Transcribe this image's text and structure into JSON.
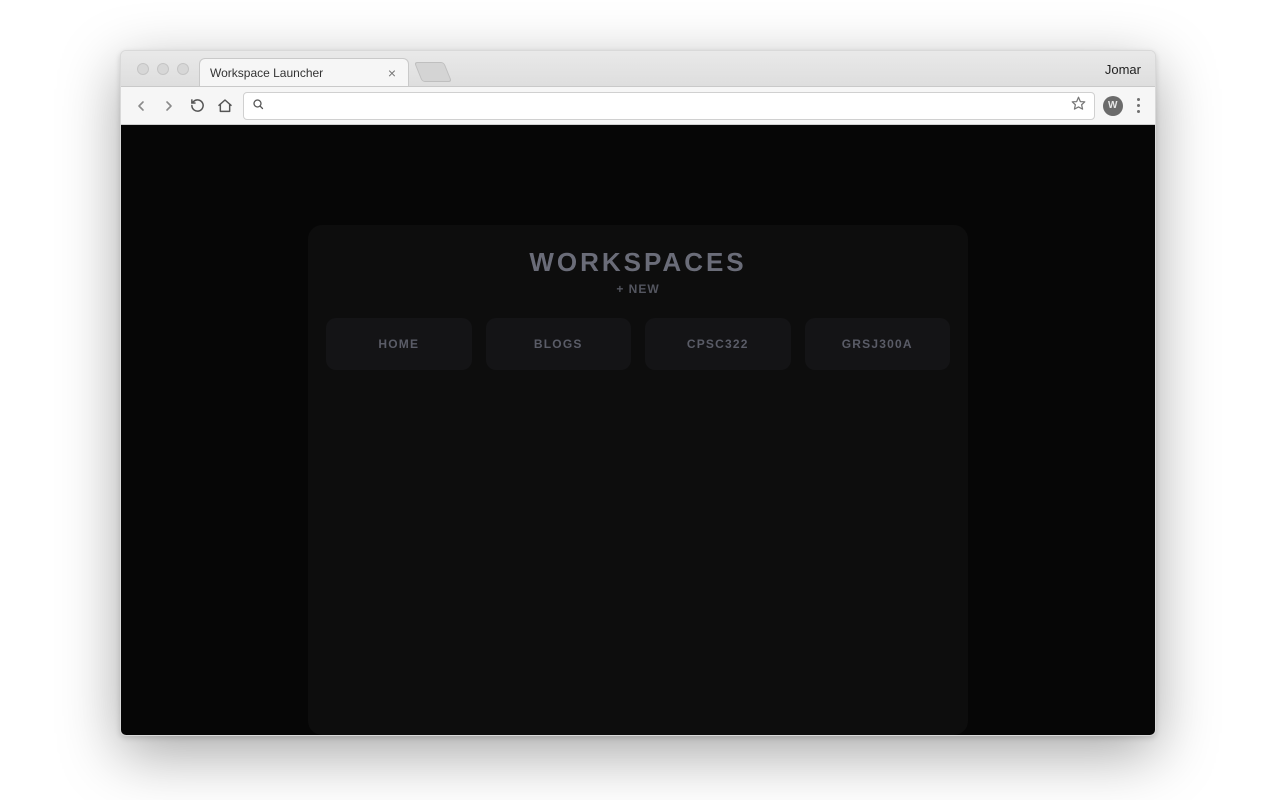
{
  "browser": {
    "tab_title": "Workspace Launcher",
    "profile_name": "Jomar",
    "avatar_letter": "W",
    "omnibox_value": "",
    "omnibox_placeholder": ""
  },
  "page": {
    "panel_title": "WORKSPACES",
    "new_label": "+ NEW",
    "tiles": [
      {
        "label": "HOME"
      },
      {
        "label": "BLOGS"
      },
      {
        "label": "CPSC322"
      },
      {
        "label": "GRSJ300A"
      }
    ]
  },
  "colors": {
    "page_bg": "#060606",
    "panel_bg": "#0d0d0d",
    "tile_bg": "#141416",
    "text_muted": "#6a6c78"
  }
}
